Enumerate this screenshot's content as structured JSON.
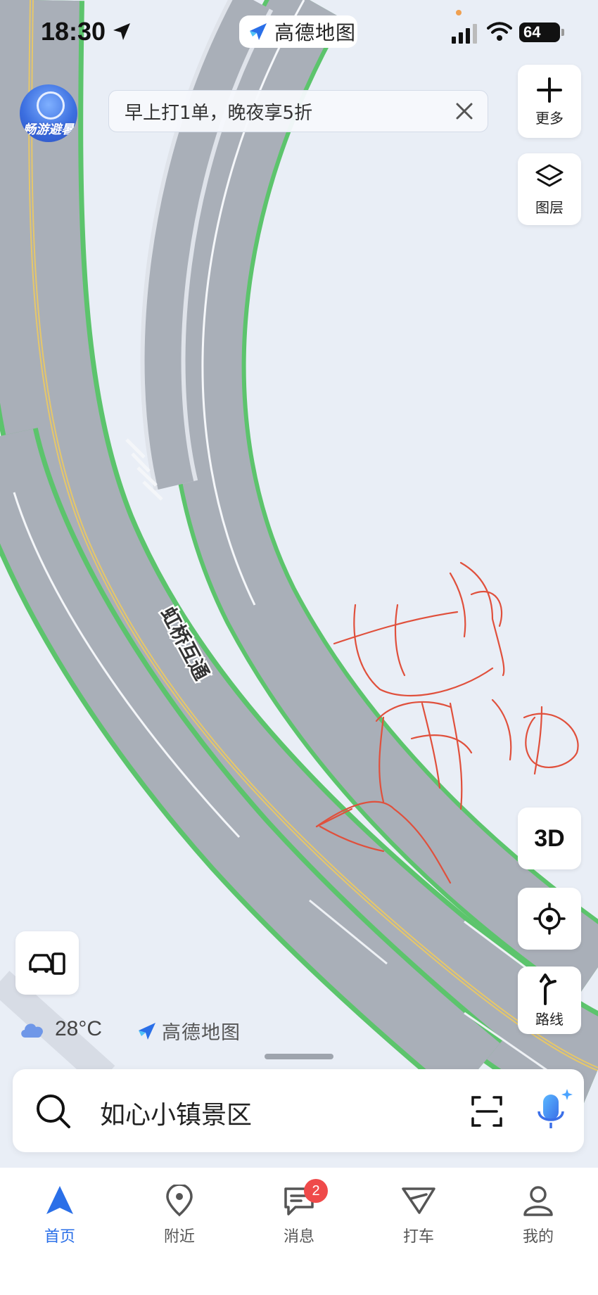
{
  "status_bar": {
    "time": "18:30",
    "battery": "64"
  },
  "brand": {
    "name": "高德地图"
  },
  "avatar": {
    "banner": "畅游避暑"
  },
  "promo": {
    "text": "早上打1单，晚夜享5折"
  },
  "side": {
    "more_label": "更多",
    "layers_label": "图层",
    "threed_label": "3D",
    "route_label": "路线"
  },
  "map": {
    "road_label": "虹桥互通",
    "handwriting": "也是 胯插"
  },
  "weather": {
    "temp": "28°C"
  },
  "map_brand": {
    "name": "高德地图"
  },
  "search": {
    "query": "如心小镇景区"
  },
  "tabs": [
    {
      "label": "首页"
    },
    {
      "label": "附近"
    },
    {
      "label": "消息",
      "badge": "2"
    },
    {
      "label": "打车"
    },
    {
      "label": "我的"
    }
  ],
  "colors": {
    "accent": "#2a6fe8",
    "road_edge": "#5cc46c",
    "badge": "#ef4a4a",
    "handwriting": "#e0503c"
  }
}
